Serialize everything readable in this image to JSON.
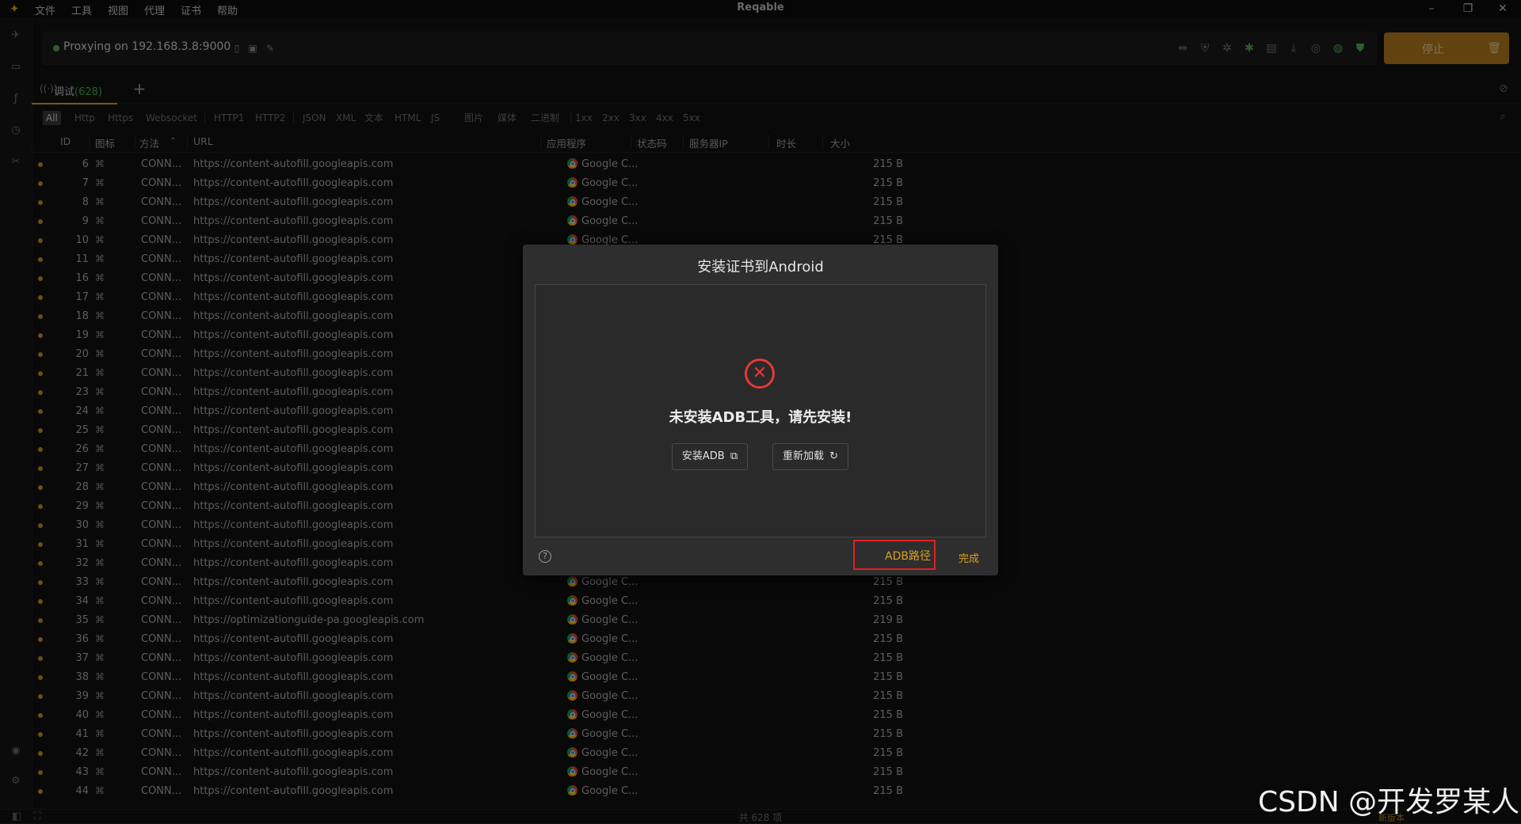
{
  "window": {
    "title": "Reqable",
    "menu": [
      "文件",
      "工具",
      "视图",
      "代理",
      "证书",
      "帮助"
    ],
    "controls": {
      "minimize": "–",
      "maximize": "❐",
      "close": "✕"
    }
  },
  "proxy": {
    "status_text": "Proxying on 192.168.3.8:9000",
    "stop_label": "停止"
  },
  "tabs": {
    "debug_label": "调试",
    "debug_count": "(628)",
    "add_label": "+"
  },
  "filters": [
    "All",
    "Http",
    "Https",
    "Websocket",
    "HTTP1",
    "HTTP2",
    "JSON",
    "XML",
    "文本",
    "HTML",
    "JS",
    "图片",
    "媒体",
    "二进制",
    "1xx",
    "2xx",
    "3xx",
    "4xx",
    "5xx"
  ],
  "table": {
    "columns": {
      "id": "ID",
      "icon": "图标",
      "method": "方法",
      "url": "URL",
      "app": "应用程序",
      "status": "状态码",
      "server_ip": "服务器IP",
      "duration": "时长",
      "size": "大小"
    },
    "sort_indicator": "⌃",
    "rows": [
      {
        "id": "6",
        "method": "CONN...",
        "url": "https://content-autofill.googleapis.com",
        "app": "Google C...",
        "size": "215 B"
      },
      {
        "id": "7",
        "method": "CONN...",
        "url": "https://content-autofill.googleapis.com",
        "app": "Google C...",
        "size": "215 B"
      },
      {
        "id": "8",
        "method": "CONN...",
        "url": "https://content-autofill.googleapis.com",
        "app": "Google C...",
        "size": "215 B"
      },
      {
        "id": "9",
        "method": "CONN...",
        "url": "https://content-autofill.googleapis.com",
        "app": "Google C...",
        "size": "215 B"
      },
      {
        "id": "10",
        "method": "CONN...",
        "url": "https://content-autofill.googleapis.com",
        "app": "Google C...",
        "size": "215 B"
      },
      {
        "id": "11",
        "method": "CONN...",
        "url": "https://content-autofill.googleapis.com",
        "app": "",
        "size": ""
      },
      {
        "id": "16",
        "method": "CONN...",
        "url": "https://content-autofill.googleapis.com",
        "app": "",
        "size": ""
      },
      {
        "id": "17",
        "method": "CONN...",
        "url": "https://content-autofill.googleapis.com",
        "app": "",
        "size": ""
      },
      {
        "id": "18",
        "method": "CONN...",
        "url": "https://content-autofill.googleapis.com",
        "app": "",
        "size": ""
      },
      {
        "id": "19",
        "method": "CONN...",
        "url": "https://content-autofill.googleapis.com",
        "app": "",
        "size": ""
      },
      {
        "id": "20",
        "method": "CONN...",
        "url": "https://content-autofill.googleapis.com",
        "app": "",
        "size": ""
      },
      {
        "id": "21",
        "method": "CONN...",
        "url": "https://content-autofill.googleapis.com",
        "app": "",
        "size": ""
      },
      {
        "id": "23",
        "method": "CONN...",
        "url": "https://content-autofill.googleapis.com",
        "app": "",
        "size": ""
      },
      {
        "id": "24",
        "method": "CONN...",
        "url": "https://content-autofill.googleapis.com",
        "app": "",
        "size": ""
      },
      {
        "id": "25",
        "method": "CONN...",
        "url": "https://content-autofill.googleapis.com",
        "app": "",
        "size": ""
      },
      {
        "id": "26",
        "method": "CONN...",
        "url": "https://content-autofill.googleapis.com",
        "app": "",
        "size": ""
      },
      {
        "id": "27",
        "method": "CONN...",
        "url": "https://content-autofill.googleapis.com",
        "app": "",
        "size": ""
      },
      {
        "id": "28",
        "method": "CONN...",
        "url": "https://content-autofill.googleapis.com",
        "app": "",
        "size": ""
      },
      {
        "id": "29",
        "method": "CONN...",
        "url": "https://content-autofill.googleapis.com",
        "app": "",
        "size": ""
      },
      {
        "id": "30",
        "method": "CONN...",
        "url": "https://content-autofill.googleapis.com",
        "app": "",
        "size": ""
      },
      {
        "id": "31",
        "method": "CONN...",
        "url": "https://content-autofill.googleapis.com",
        "app": "",
        "size": ""
      },
      {
        "id": "32",
        "method": "CONN...",
        "url": "https://content-autofill.googleapis.com",
        "app": "",
        "size": ""
      },
      {
        "id": "33",
        "method": "CONN...",
        "url": "https://content-autofill.googleapis.com",
        "app": "Google C...",
        "size": "215 B"
      },
      {
        "id": "34",
        "method": "CONN...",
        "url": "https://content-autofill.googleapis.com",
        "app": "Google C...",
        "size": "215 B"
      },
      {
        "id": "35",
        "method": "CONN...",
        "url": "https://optimizationguide-pa.googleapis.com",
        "app": "Google C...",
        "size": "219 B"
      },
      {
        "id": "36",
        "method": "CONN...",
        "url": "https://content-autofill.googleapis.com",
        "app": "Google C...",
        "size": "215 B"
      },
      {
        "id": "37",
        "method": "CONN...",
        "url": "https://content-autofill.googleapis.com",
        "app": "Google C...",
        "size": "215 B"
      },
      {
        "id": "38",
        "method": "CONN...",
        "url": "https://content-autofill.googleapis.com",
        "app": "Google C...",
        "size": "215 B"
      },
      {
        "id": "39",
        "method": "CONN...",
        "url": "https://content-autofill.googleapis.com",
        "app": "Google C...",
        "size": "215 B"
      },
      {
        "id": "40",
        "method": "CONN...",
        "url": "https://content-autofill.googleapis.com",
        "app": "Google C...",
        "size": "215 B"
      },
      {
        "id": "41",
        "method": "CONN...",
        "url": "https://content-autofill.googleapis.com",
        "app": "Google C...",
        "size": "215 B"
      },
      {
        "id": "42",
        "method": "CONN...",
        "url": "https://content-autofill.googleapis.com",
        "app": "Google C...",
        "size": "215 B"
      },
      {
        "id": "43",
        "method": "CONN...",
        "url": "https://content-autofill.googleapis.com",
        "app": "Google C...",
        "size": "215 B"
      },
      {
        "id": "44",
        "method": "CONN...",
        "url": "https://content-autofill.googleapis.com",
        "app": "Google C...",
        "size": "215 B"
      }
    ]
  },
  "status_bar": {
    "count_text": "共 628 项",
    "new_version": "新版本"
  },
  "dialog": {
    "title": "安装证书到Android",
    "error_message": "未安装ADB工具，请先安装!",
    "install_adb_label": "安装ADB",
    "reload_label": "重新加载",
    "adb_path_label": "ADB路径",
    "done_label": "完成"
  },
  "watermark": "CSDN @开发罗某人",
  "colors": {
    "accent": "#d9a025",
    "stop_button": "#b27a1c",
    "error": "#e53935",
    "highlight_box": "#e02020",
    "status_green": "#4caf50"
  },
  "icons": {
    "rail": [
      "send-icon",
      "inbox-icon",
      "function-icon",
      "history-icon",
      "tools-icon",
      "account-icon",
      "settings-icon"
    ],
    "toolbar": [
      "split-icon",
      "shield-icon",
      "bug-off-icon",
      "bug-icon",
      "document-icon",
      "download-icon",
      "badge-icon",
      "globe-icon",
      "shield-check-icon"
    ]
  }
}
